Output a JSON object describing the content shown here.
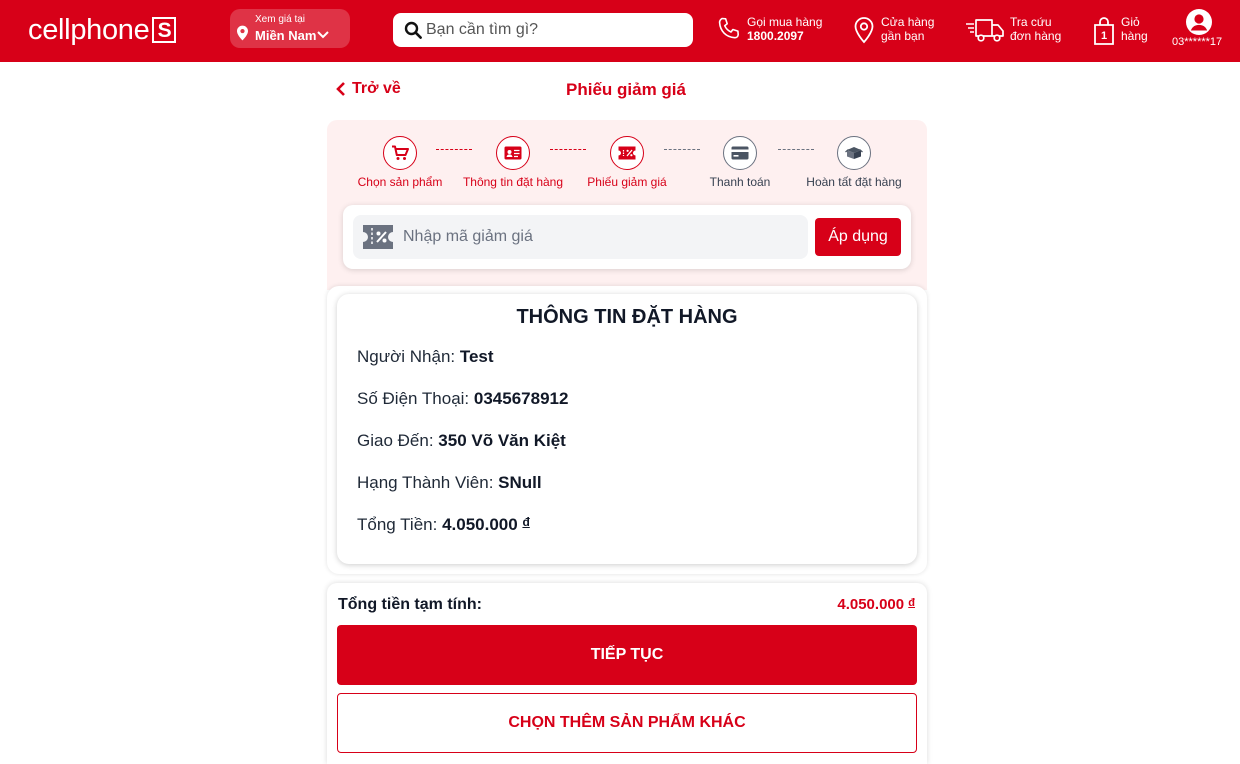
{
  "header": {
    "logo_text": "cellphone",
    "logo_mark": "S",
    "region_caption": "Xem giá tại",
    "region_value": "Miền Nam",
    "search_placeholder": "Bạn cần tìm gì?",
    "hotline_label": "Gọi mua hàng",
    "hotline_number": "1800.2097",
    "store_line1": "Cửa hàng",
    "store_line2": "gần bạn",
    "track_line1": "Tra cứu",
    "track_line2": "đơn hàng",
    "cart_line1": "Giỏ",
    "cart_line2": "hàng",
    "cart_count": "1",
    "user_name": "03******17",
    "brand_color": "#d70018"
  },
  "page": {
    "back_label": "Trở về",
    "title": "Phiếu giảm giá"
  },
  "steps": [
    {
      "label": "Chọn sản phẩm",
      "icon": "cart-icon",
      "active": true
    },
    {
      "label": "Thông tin đặt hàng",
      "icon": "id-card-icon",
      "active": true
    },
    {
      "label": "Phiếu giảm giá",
      "icon": "coupon-icon",
      "active": true
    },
    {
      "label": "Thanh toán",
      "icon": "credit-card-icon",
      "active": false
    },
    {
      "label": "Hoàn tất đặt hàng",
      "icon": "box-icon",
      "active": false
    }
  ],
  "coupon": {
    "placeholder": "Nhập mã giảm giá",
    "apply_label": "Áp dụng"
  },
  "order_info": {
    "title": "THÔNG TIN ĐẶT HÀNG",
    "recipient_label": "Người Nhận:",
    "recipient_value": "Test",
    "phone_label": "Số Điện Thoại:",
    "phone_value": "0345678912",
    "address_label": "Giao Đến:",
    "address_value": "350 Võ Văn Kiệt",
    "tier_label": "Hạng Thành Viên:",
    "tier_value": "SNull",
    "total_label": "Tổng Tiền:",
    "total_value": "4.050.000",
    "currency": "đ"
  },
  "summary": {
    "subtotal_label": "Tổng tiền tạm tính:",
    "subtotal_value": "4.050.000",
    "currency": "đ",
    "continue_label": "TIẾP TỤC",
    "more_label": "CHỌN THÊM SẢN PHẨM KHÁC"
  }
}
